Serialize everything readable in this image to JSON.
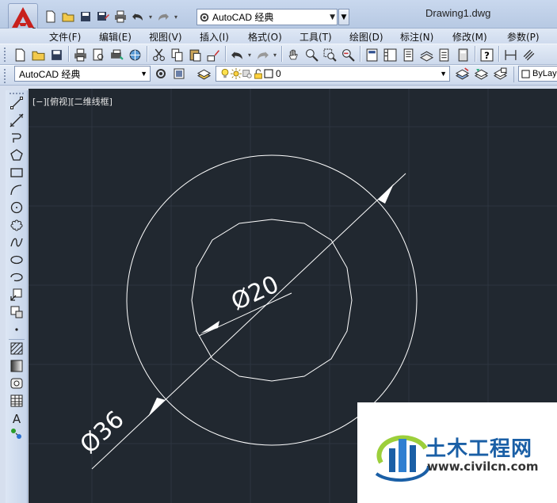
{
  "window": {
    "doc_title": "Drawing1.dwg",
    "workspace": "AutoCAD 经典"
  },
  "menubar": {
    "items": [
      {
        "label": "文件(F)"
      },
      {
        "label": "编辑(E)"
      },
      {
        "label": "视图(V)"
      },
      {
        "label": "插入(I)"
      },
      {
        "label": "格式(O)"
      },
      {
        "label": "工具(T)"
      },
      {
        "label": "绘图(D)"
      },
      {
        "label": "标注(N)"
      },
      {
        "label": "修改(M)"
      },
      {
        "label": "参数(P)"
      }
    ]
  },
  "toolbar2": {
    "workspace_combo": "AutoCAD 经典",
    "layer_value": "0",
    "color_value": "ByLaye"
  },
  "canvas": {
    "viewport_label": "[−][俯视][二维线框]",
    "background": "#212830",
    "dim_outer": "Ø36",
    "dim_inner": "Ø20"
  },
  "watermark": {
    "brand": "土木工程网",
    "url": "www.civilcn.com"
  },
  "colors": {
    "accent_red": "#c8201c",
    "watermark_blue": "#1a5fa6"
  }
}
